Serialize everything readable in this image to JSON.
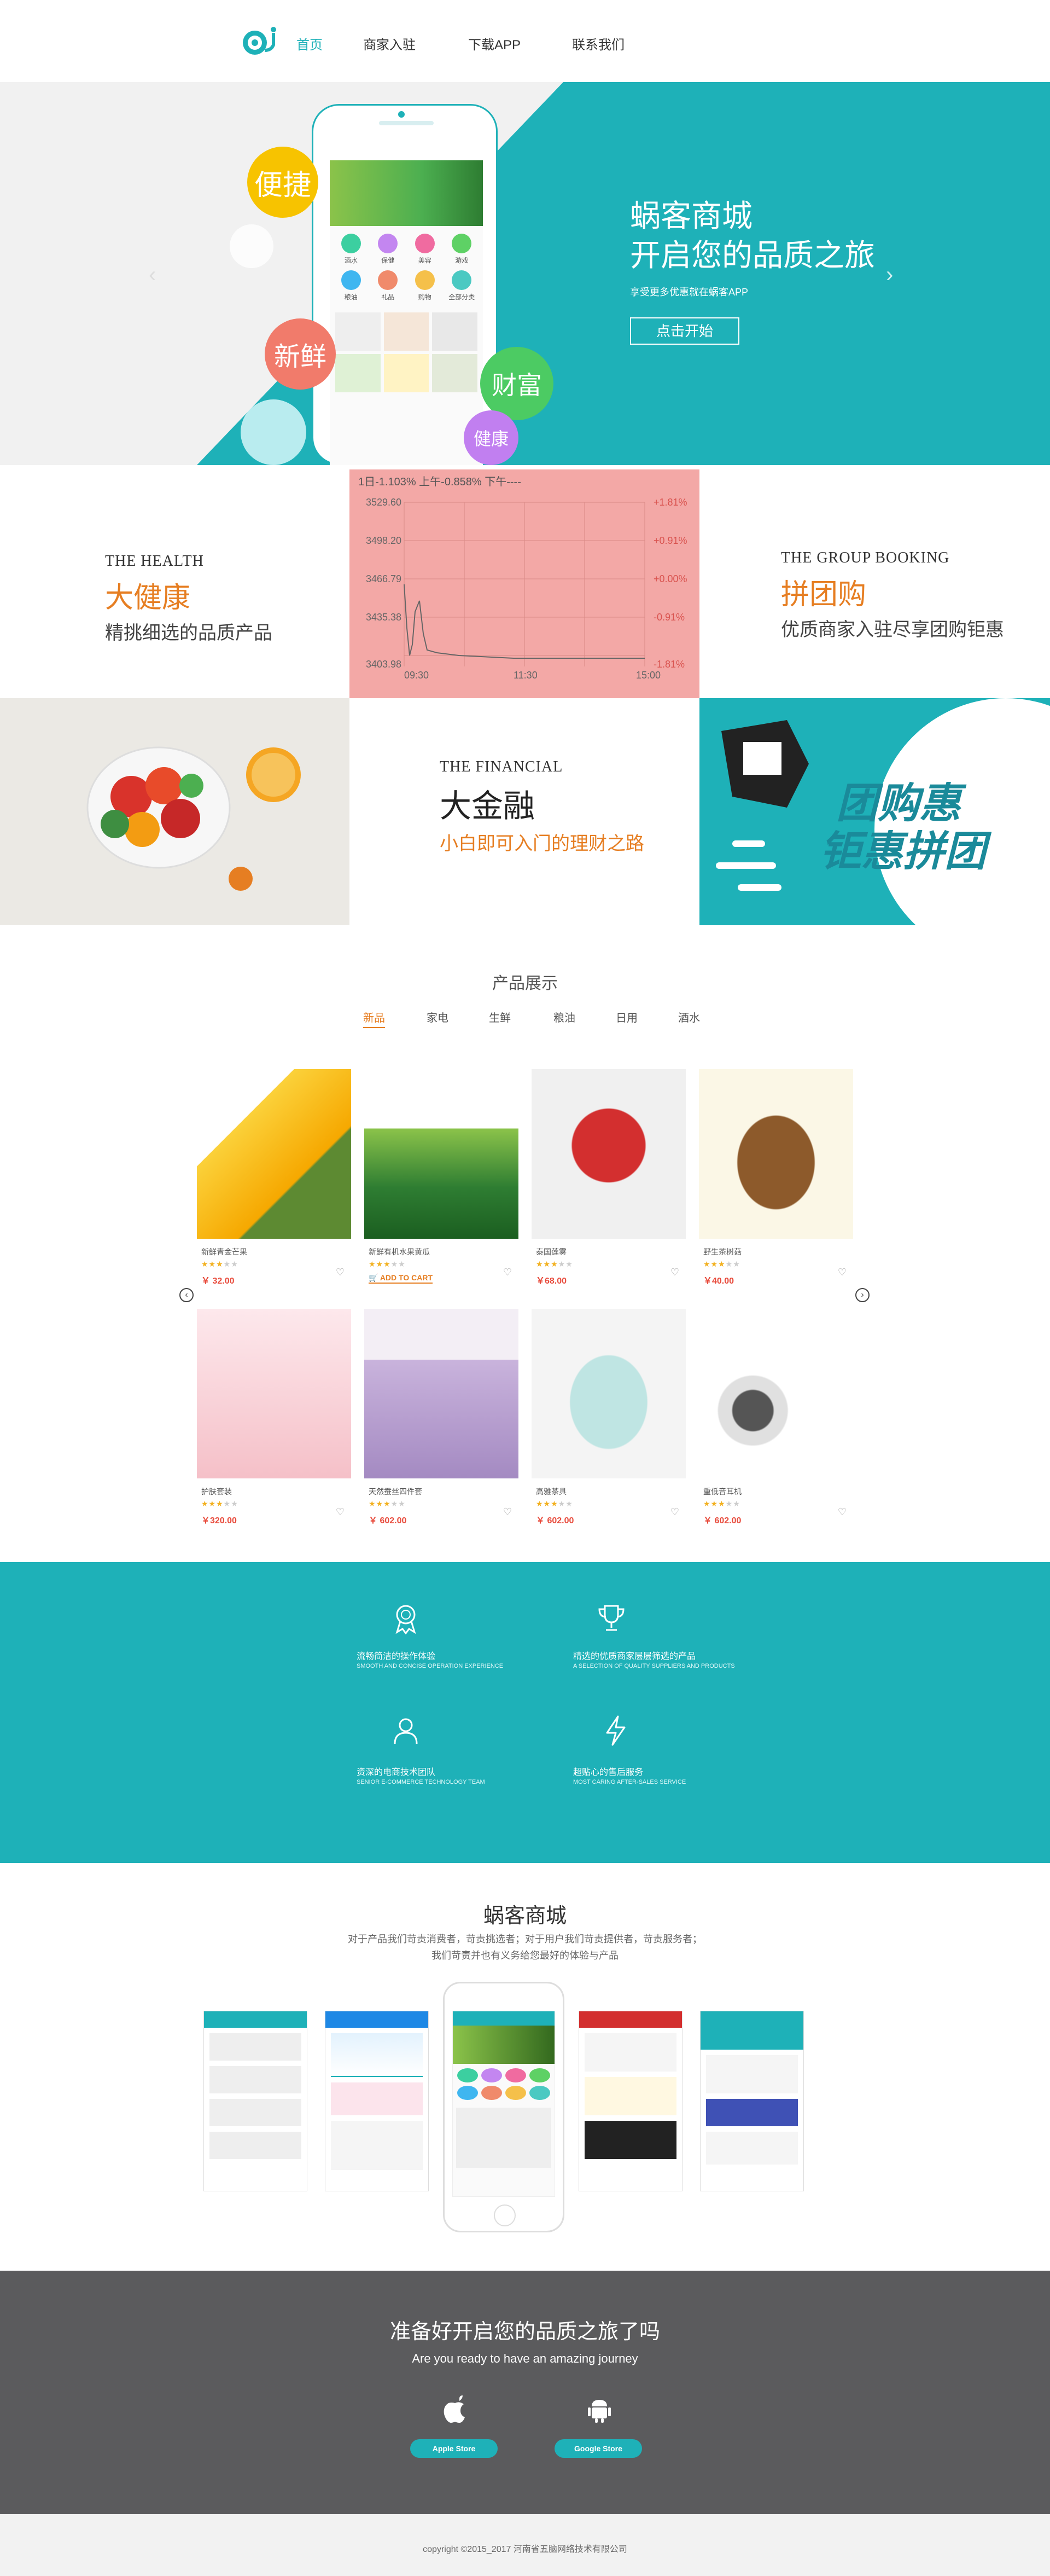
{
  "nav": {
    "items": [
      {
        "label": "首页",
        "active": true
      },
      {
        "label": "商家入驻",
        "active": false
      },
      {
        "label": "下载APP",
        "active": false
      },
      {
        "label": "联系我们",
        "active": false
      }
    ],
    "accent": "#1eb1b8"
  },
  "hero": {
    "title_line1": "蜗客商城",
    "title_line2": "开启您的品质之旅",
    "subtitle": "享受更多优惠就在蜗客APP",
    "button": "点击开始",
    "bubbles": [
      "便捷",
      "新鲜",
      "财富",
      "健康"
    ],
    "phone_icons": [
      "酒水",
      "保健",
      "美容",
      "游戏",
      "粮油",
      "礼品",
      "购物",
      "全部分类"
    ],
    "prev_icon": "chevron-left-icon",
    "next_icon": "chevron-right-icon"
  },
  "features": {
    "health": {
      "en": "THE HEALTH",
      "cn": "大健康",
      "desc": "精挑细选的品质产品"
    },
    "group": {
      "en": "THE GROUP BOOKING",
      "cn": "拼团购",
      "desc": "优质商家入驻尽享团购钜惠"
    },
    "financial": {
      "en": "THE FINANCIAL",
      "cn": "大金融",
      "desc": "小白即可入门的理财之路"
    },
    "banner_text": [
      "团购惠",
      "钜惠拼团"
    ]
  },
  "stock_chart": {
    "header": "1日-1.103% 上午-0.858% 下午----",
    "y_labels": [
      "3529.60",
      "3498.20",
      "3466.79",
      "3435.38",
      "3403.98"
    ],
    "pct_labels": [
      "+1.81%",
      "+0.91%",
      "+0.00%",
      "-0.91%",
      "-1.81%"
    ],
    "x_labels": [
      "09:30",
      "11:30",
      "15:00"
    ]
  },
  "products": {
    "title": "产品展示",
    "tabs": [
      "新品",
      "家电",
      "生鲜",
      "粮油",
      "日用",
      "酒水"
    ],
    "add_to_cart": "ADD TO CART",
    "items": [
      {
        "name": "新鲜青金芒果",
        "price": "￥ 32.00",
        "stars": 3
      },
      {
        "name": "新鲜有机水果黄瓜",
        "price": "",
        "stars": 3
      },
      {
        "name": "泰国莲雾",
        "price": "￥68.00",
        "stars": 3
      },
      {
        "name": "野生茶树菇",
        "price": "￥40.00",
        "stars": 3
      },
      {
        "name": "护肤套装",
        "price": "￥320.00",
        "stars": 3
      },
      {
        "name": "天然蚕丝四件套",
        "price": "￥ 602.00",
        "stars": 3
      },
      {
        "name": "高雅茶具",
        "price": "￥ 602.00",
        "stars": 3
      },
      {
        "name": "重低音耳机",
        "price": "￥ 602.00",
        "stars": 3
      }
    ]
  },
  "services": {
    "items": [
      {
        "cn": "流畅简洁的操作体验",
        "en": "SMOOTH AND CONCISE OPERATION EXPERIENCE",
        "icon": "award-icon"
      },
      {
        "cn": "精选的优质商家层层筛选的产品",
        "en": "A SELECTION OF QUALITY SUPPLIERS AND PRODUCTS",
        "icon": "trophy-icon"
      },
      {
        "cn": "资深的电商技术团队",
        "en": "SENIOR E-COMMERCE TECHNOLOGY TEAM",
        "icon": "team-icon"
      },
      {
        "cn": "超贴心的售后服务",
        "en": "MOST CARING AFTER-SALES SERVICE",
        "icon": "lightning-icon"
      }
    ]
  },
  "app": {
    "title": "蜗客商城",
    "desc1": "对于产品我们苛责消费者，苛责挑选者；对于用户我们苛责提供者，苛责服务者；",
    "desc2": "我们苛责并也有义务给您最好的体验与产品"
  },
  "cta": {
    "title": "准备好开启您的品质之旅了吗",
    "subtitle": "Are you ready to have an amazing journey",
    "apple": "Apple Store",
    "google": "Google Store"
  },
  "footer": {
    "copyright": "copyright ©2015_2017 河南省五脑网络技术有限公司"
  }
}
